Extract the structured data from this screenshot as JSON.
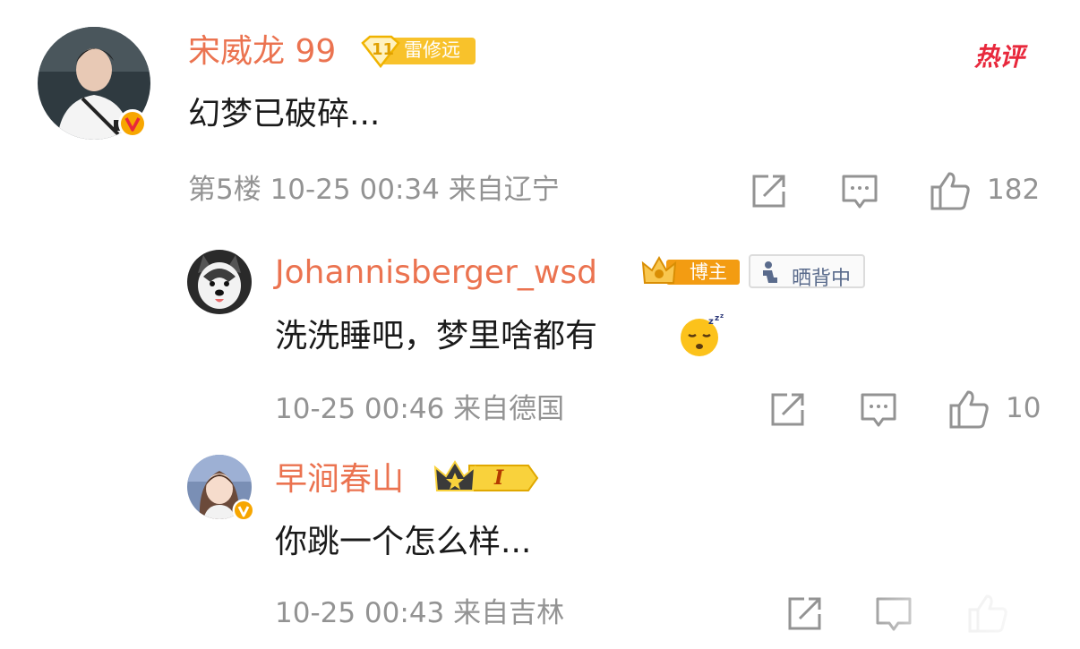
{
  "main_comment": {
    "user": "宋威龙 99",
    "level": "11",
    "fan_badge": "雷修远",
    "hot_tag": "热评",
    "text": "幻梦已破碎...",
    "meta": "第5楼 10-25 00:34 来自辽宁",
    "likes": "182"
  },
  "replies": [
    {
      "user": "Johannisberger_wsd",
      "badge": "博主",
      "badge2": "晒背中",
      "text": "洗洗睡吧，梦里啥都有",
      "meta": "10-25 00:46 来自德国",
      "likes": "10"
    },
    {
      "user": "早涧春山",
      "badge": "I",
      "text": "你跳一个怎么样...",
      "meta": "10-25 00:43 来自吉林"
    }
  ],
  "colors": {
    "username": "#eb7350",
    "meta": "#939393",
    "verified": "#f7a600",
    "hot": "#e8283c"
  }
}
